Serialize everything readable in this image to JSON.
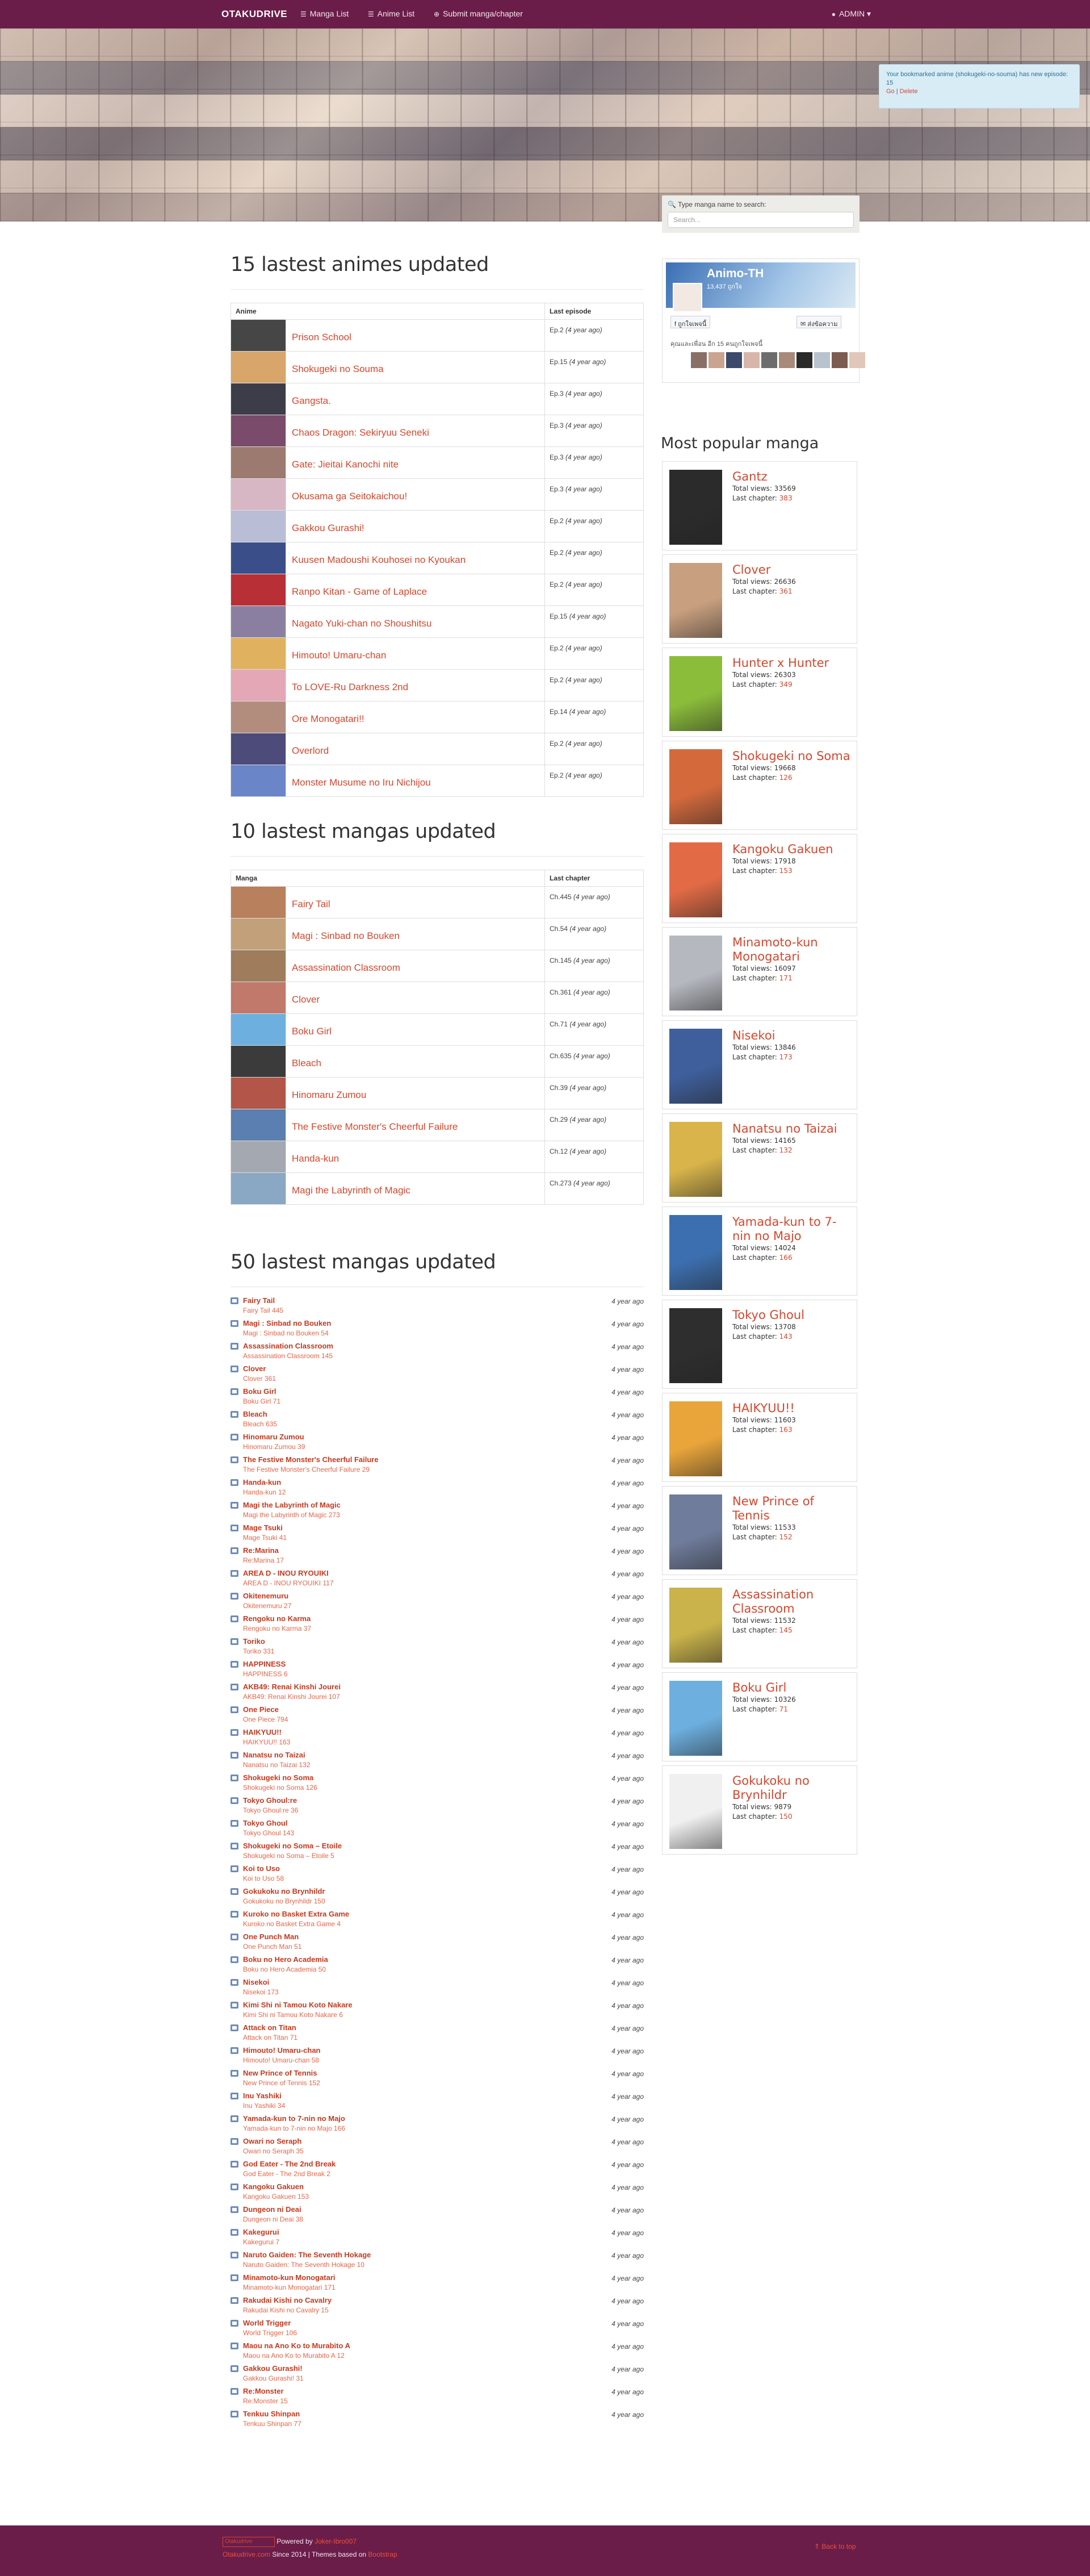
{
  "nav": {
    "brand": "OTAKUDRIVE",
    "manga": "Manga List",
    "anime": "Anime List",
    "submit": "Submit manga/chapter",
    "admin": "ADMIN ▾"
  },
  "alert": {
    "text": "Your bookmarked anime (shokugeki-no-souma) has new episode: 15",
    "action1": "Go",
    "sep": "|",
    "action2": "Delete"
  },
  "search": {
    "label": "Type manga name to search:",
    "placeholder": "Search..."
  },
  "anime_section": {
    "title": "15 lastest animes updated",
    "col1": "Anime",
    "col2": "Last episode",
    "rows": [
      {
        "name": "Prison School",
        "ep": "Ep.2",
        "ago": "(4 year ago)",
        "c": "#464646"
      },
      {
        "name": "Shokugeki no Souma",
        "ep": "Ep.15",
        "ago": "(4 year ago)",
        "c": "#d8a66b"
      },
      {
        "name": "Gangsta.",
        "ep": "Ep.3",
        "ago": "(4 year ago)",
        "c": "#3d3d4a"
      },
      {
        "name": "Chaos Dragon: Sekiryuu Seneki",
        "ep": "Ep.3",
        "ago": "(4 year ago)",
        "c": "#7a4b6a"
      },
      {
        "name": "Gate: Jieitai Kanochi nite",
        "ep": "Ep.3",
        "ago": "(4 year ago)",
        "c": "#9d7a6f"
      },
      {
        "name": "Okusama ga Seitokaichou!",
        "ep": "Ep.3",
        "ago": "(4 year ago)",
        "c": "#d8b7c4"
      },
      {
        "name": "Gakkou Gurashi!",
        "ep": "Ep.2",
        "ago": "(4 year ago)",
        "c": "#b9bdd6"
      },
      {
        "name": "Kuusen Madoushi Kouhosei no Kyoukan",
        "ep": "Ep.2",
        "ago": "(4 year ago)",
        "c": "#3a4f8a"
      },
      {
        "name": "Ranpo Kitan - Game of Laplace",
        "ep": "Ep.2",
        "ago": "(4 year ago)",
        "c": "#b83036"
      },
      {
        "name": "Nagato Yuki-chan no Shoushitsu",
        "ep": "Ep.15",
        "ago": "(4 year ago)",
        "c": "#8b7fa1"
      },
      {
        "name": "Himouto! Umaru-chan",
        "ep": "Ep.2",
        "ago": "(4 year ago)",
        "c": "#e0b25f"
      },
      {
        "name": "To LOVE-Ru Darkness 2nd",
        "ep": "Ep.2",
        "ago": "(4 year ago)",
        "c": "#e3a7b6"
      },
      {
        "name": "Ore Monogatari!!",
        "ep": "Ep.14",
        "ago": "(4 year ago)",
        "c": "#b28d7e"
      },
      {
        "name": "Overlord",
        "ep": "Ep.2",
        "ago": "(4 year ago)",
        "c": "#4d4b7a"
      },
      {
        "name": "Monster Musume no Iru Nichijou",
        "ep": "Ep.2",
        "ago": "(4 year ago)",
        "c": "#6b85c9"
      }
    ]
  },
  "manga_section": {
    "title": "10 lastest mangas updated",
    "col1": "Manga",
    "col2": "Last chapter",
    "rows": [
      {
        "name": "Fairy Tail",
        "ch": "Ch.445",
        "ago": "(4 year ago)",
        "c": "#b8805c"
      },
      {
        "name": "Magi : Sinbad no Bouken",
        "ch": "Ch.54",
        "ago": "(4 year ago)",
        "c": "#c2a17a"
      },
      {
        "name": "Assassination Classroom",
        "ch": "Ch.145",
        "ago": "(4 year ago)",
        "c": "#9e7c5c"
      },
      {
        "name": "Clover",
        "ch": "Ch.361",
        "ago": "(4 year ago)",
        "c": "#c0796a"
      },
      {
        "name": "Boku Girl",
        "ch": "Ch.71",
        "ago": "(4 year ago)",
        "c": "#6db0e0"
      },
      {
        "name": "Bleach",
        "ch": "Ch.635",
        "ago": "(4 year ago)",
        "c": "#3b3b3b"
      },
      {
        "name": "Hinomaru Zumou",
        "ch": "Ch.39",
        "ago": "(4 year ago)",
        "c": "#b35548"
      },
      {
        "name": "The Festive Monster's Cheerful Failure",
        "ch": "Ch.29",
        "ago": "(4 year ago)",
        "c": "#5a7fb0"
      },
      {
        "name": "Handa-kun",
        "ch": "Ch.12",
        "ago": "(4 year ago)",
        "c": "#a4a8b0"
      },
      {
        "name": "Magi the Labyrinth of Magic",
        "ch": "Ch.273",
        "ago": "(4 year ago)",
        "c": "#8aa7c4"
      }
    ]
  },
  "list50": {
    "title": "50 lastest mangas updated",
    "items": [
      {
        "t": "Fairy Tail",
        "s": "Fairy Tail 445",
        "a": "4 year ago"
      },
      {
        "t": "Magi : Sinbad no Bouken",
        "s": "Magi : Sinbad no Bouken 54",
        "a": "4 year ago"
      },
      {
        "t": "Assassination Classroom",
        "s": "Assassination Classroom 145",
        "a": "4 year ago"
      },
      {
        "t": "Clover",
        "s": "Clover 361",
        "a": "4 year ago"
      },
      {
        "t": "Boku Girl",
        "s": "Boku Girl 71",
        "a": "4 year ago"
      },
      {
        "t": "Bleach",
        "s": "Bleach 635",
        "a": "4 year ago"
      },
      {
        "t": "Hinomaru Zumou",
        "s": "Hinomaru Zumou 39",
        "a": "4 year ago"
      },
      {
        "t": "The Festive Monster's Cheerful Failure",
        "s": "The Festive Monster's Cheerful Failure 29",
        "a": "4 year ago"
      },
      {
        "t": "Handa-kun",
        "s": "Handa-kun 12",
        "a": "4 year ago"
      },
      {
        "t": "Magi the Labyrinth of Magic",
        "s": "Magi the Labyrinth of Magic 273",
        "a": "4 year ago"
      },
      {
        "t": "Mage Tsuki",
        "s": "Mage Tsuki 41",
        "a": "4 year ago"
      },
      {
        "t": "Re:Marina",
        "s": "Re:Marina 17",
        "a": "4 year ago"
      },
      {
        "t": "AREA D - INOU RYOUIKI",
        "s": "AREA D - INOU RYOUIKI 117",
        "a": "4 year ago"
      },
      {
        "t": "Okitenemuru",
        "s": "Okitenemuru 27",
        "a": "4 year ago"
      },
      {
        "t": "Rengoku no Karma",
        "s": "Rengoku no Karma 37",
        "a": "4 year ago"
      },
      {
        "t": "Toriko",
        "s": "Toriko 331",
        "a": "4 year ago"
      },
      {
        "t": "HAPPINESS",
        "s": "HAPPINESS 6",
        "a": "4 year ago"
      },
      {
        "t": "AKB49: Renai Kinshi Jourei",
        "s": "AKB49: Renai Kinshi Jourei 107",
        "a": "4 year ago"
      },
      {
        "t": "One Piece",
        "s": "One Piece 794",
        "a": "4 year ago"
      },
      {
        "t": "HAIKYUU!!",
        "s": "HAIKYUU!! 163",
        "a": "4 year ago"
      },
      {
        "t": "Nanatsu no Taizai",
        "s": "Nanatsu no Taizai 132",
        "a": "4 year ago"
      },
      {
        "t": "Shokugeki no Soma",
        "s": "Shokugeki no Soma 126",
        "a": "4 year ago"
      },
      {
        "t": "Tokyo Ghoul:re",
        "s": "Tokyo Ghoul:re 36",
        "a": "4 year ago"
      },
      {
        "t": "Tokyo Ghoul",
        "s": "Tokyo Ghoul 143",
        "a": "4 year ago"
      },
      {
        "t": "Shokugeki no Soma – Etoile",
        "s": "Shokugeki no Soma – Etoile 5",
        "a": "4 year ago"
      },
      {
        "t": "Koi to Uso",
        "s": "Koi to Uso 58",
        "a": "4 year ago"
      },
      {
        "t": "Gokukoku no Brynhildr",
        "s": "Gokukoku no Brynhildr 150",
        "a": "4 year ago"
      },
      {
        "t": "Kuroko no Basket Extra Game",
        "s": "Kuroko no Basket Extra Game 4",
        "a": "4 year ago"
      },
      {
        "t": "One Punch Man",
        "s": "One Punch Man 51",
        "a": "4 year ago"
      },
      {
        "t": "Boku no Hero Academia",
        "s": "Boku no Hero Academia 50",
        "a": "4 year ago"
      },
      {
        "t": "Nisekoi",
        "s": "Nisekoi 173",
        "a": "4 year ago"
      },
      {
        "t": "Kimi Shi ni Tamou Koto Nakare",
        "s": "Kimi Shi ni Tamou Koto Nakare 6",
        "a": "4 year ago"
      },
      {
        "t": "Attack on Titan",
        "s": "Attack on Titan 71",
        "a": "4 year ago"
      },
      {
        "t": "Himouto! Umaru-chan",
        "s": "Himouto! Umaru-chan 58",
        "a": "4 year ago"
      },
      {
        "t": "New Prince of Tennis",
        "s": "New Prince of Tennis 152",
        "a": "4 year ago"
      },
      {
        "t": "Inu Yashiki",
        "s": "Inu Yashiki 34",
        "a": "4 year ago"
      },
      {
        "t": "Yamada-kun to 7-nin no Majo",
        "s": "Yamada-kun to 7-nin no Majo 166",
        "a": "4 year ago"
      },
      {
        "t": "Owari no Seraph",
        "s": "Owari no Seraph 35",
        "a": "4 year ago"
      },
      {
        "t": "God Eater - The 2nd Break",
        "s": "God Eater - The 2nd Break 2",
        "a": "4 year ago"
      },
      {
        "t": "Kangoku Gakuen",
        "s": "Kangoku Gakuen 153",
        "a": "4 year ago"
      },
      {
        "t": "Dungeon ni Deai",
        "s": "Dungeon ni Deai 38",
        "a": "4 year ago"
      },
      {
        "t": "Kakegurui",
        "s": "Kakegurui 7",
        "a": "4 year ago"
      },
      {
        "t": "Naruto Gaiden: The Seventh Hokage",
        "s": "Naruto Gaiden: The Seventh Hokage 10",
        "a": "4 year ago"
      },
      {
        "t": "Minamoto-kun Monogatari",
        "s": "Minamoto-kun Monogatari 171",
        "a": "4 year ago"
      },
      {
        "t": "Rakudai Kishi no Cavalry",
        "s": "Rakudai Kishi no Cavalry 15",
        "a": "4 year ago"
      },
      {
        "t": "World Trigger",
        "s": "World Trigger 106",
        "a": "4 year ago"
      },
      {
        "t": "Maou na Ano Ko to Murabito A",
        "s": "Maou na Ano Ko to Murabito A 12",
        "a": "4 year ago"
      },
      {
        "t": "Gakkou Gurashi!",
        "s": "Gakkou Gurashi! 31",
        "a": "4 year ago"
      },
      {
        "t": "Re:Monster",
        "s": "Re:Monster 15",
        "a": "4 year ago"
      },
      {
        "t": "Tenkuu Shinpan",
        "s": "Tenkuu Shinpan 77",
        "a": "4 year ago"
      }
    ]
  },
  "facebook": {
    "name": "Animo-TH",
    "likes": "13,437 ถูกใจ",
    "btn1": "ถูกใจเพจนี้",
    "btn2": "ส่งข้อความ",
    "friends": "คุณและเพื่อน อีก 15 คนถูกใจเพจนี้"
  },
  "popular": {
    "title": "Most popular manga",
    "views_label": "Total views:",
    "last_label": "Last chapter:",
    "items": [
      {
        "t": "Gantz",
        "v": "33569",
        "l": "383",
        "c": "#2b2b2b"
      },
      {
        "t": "Clover",
        "v": "26636",
        "l": "361",
        "c": "#c9a07f"
      },
      {
        "t": "Hunter x Hunter",
        "v": "26303",
        "l": "349",
        "c": "#8bbd3a"
      },
      {
        "t": "Shokugeki no Soma",
        "v": "19668",
        "l": "126",
        "c": "#d46a3c"
      },
      {
        "t": "Kangoku Gakuen",
        "v": "17918",
        "l": "153",
        "c": "#e26b45"
      },
      {
        "t": "Minamoto-kun Monogatari",
        "v": "16097",
        "l": "171",
        "c": "#b5b8bf"
      },
      {
        "t": "Nisekoi",
        "v": "13846",
        "l": "173",
        "c": "#3e5f9c"
      },
      {
        "t": "Nanatsu no Taizai",
        "v": "14165",
        "l": "132",
        "c": "#d8b44a"
      },
      {
        "t": "Yamada-kun to 7-nin no Majo",
        "v": "14024",
        "l": "166",
        "c": "#3c6fb0"
      },
      {
        "t": "Tokyo Ghoul",
        "v": "13708",
        "l": "143",
        "c": "#2e2e2e"
      },
      {
        "t": "HAIKYUU!!",
        "v": "11603",
        "l": "163",
        "c": "#e9a53a"
      },
      {
        "t": "New Prince of Tennis",
        "v": "11533",
        "l": "152",
        "c": "#6f7c9b"
      },
      {
        "t": "Assassination Classroom",
        "v": "11532",
        "l": "145",
        "c": "#c9b34a"
      },
      {
        "t": "Boku Girl",
        "v": "10326",
        "l": "71",
        "c": "#6db0e0"
      },
      {
        "t": "Gokukoku no Brynhildr",
        "v": "9879",
        "l": "150",
        "c": "#f0f0f0"
      }
    ]
  },
  "footer": {
    "logo": "Otakudrive",
    "powered": "Powered by",
    "author": "Joker-Ibro007",
    "site": "Otakudrive.com",
    "since": "Since 2014 | Themes based on",
    "theme": "Bootstrap",
    "top": "Back to top"
  }
}
